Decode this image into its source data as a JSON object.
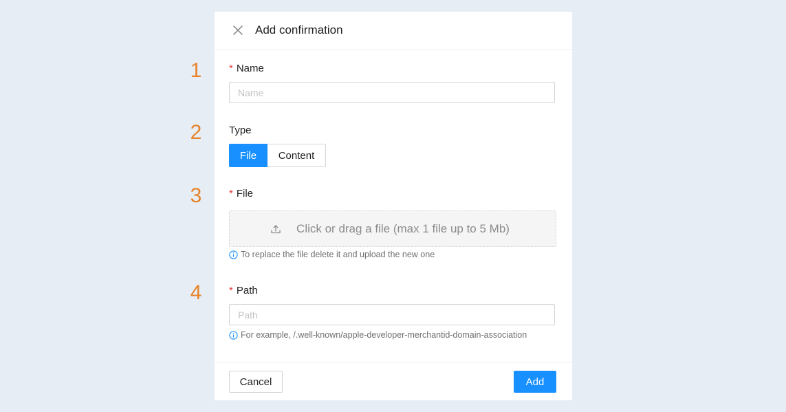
{
  "steps": [
    "1",
    "2",
    "3",
    "4"
  ],
  "dialog": {
    "title": "Add confirmation",
    "close_icon": "close-icon"
  },
  "form": {
    "required_mark": "*",
    "name": {
      "label": "Name",
      "placeholder": "Name",
      "value": ""
    },
    "type": {
      "label": "Type",
      "options": [
        "File",
        "Content"
      ],
      "selected": "File"
    },
    "file": {
      "label": "File",
      "upload_text": "Click or drag a file (max 1 file up to 5 Mb)",
      "upload_icon": "upload-icon",
      "hint": "To replace the file delete it and upload the new one",
      "hint_icon": "info-icon"
    },
    "path": {
      "label": "Path",
      "placeholder": "Path",
      "value": "",
      "hint": "For example, /.well-known/apple-developer-merchantid-domain-association",
      "hint_icon": "info-icon"
    }
  },
  "footer": {
    "cancel_label": "Cancel",
    "add_label": "Add"
  },
  "colors": {
    "background": "#e6edf5",
    "accent": "#1890ff",
    "step_number": "#e8832a",
    "required": "#e03b3b",
    "info": "#1890ff"
  }
}
